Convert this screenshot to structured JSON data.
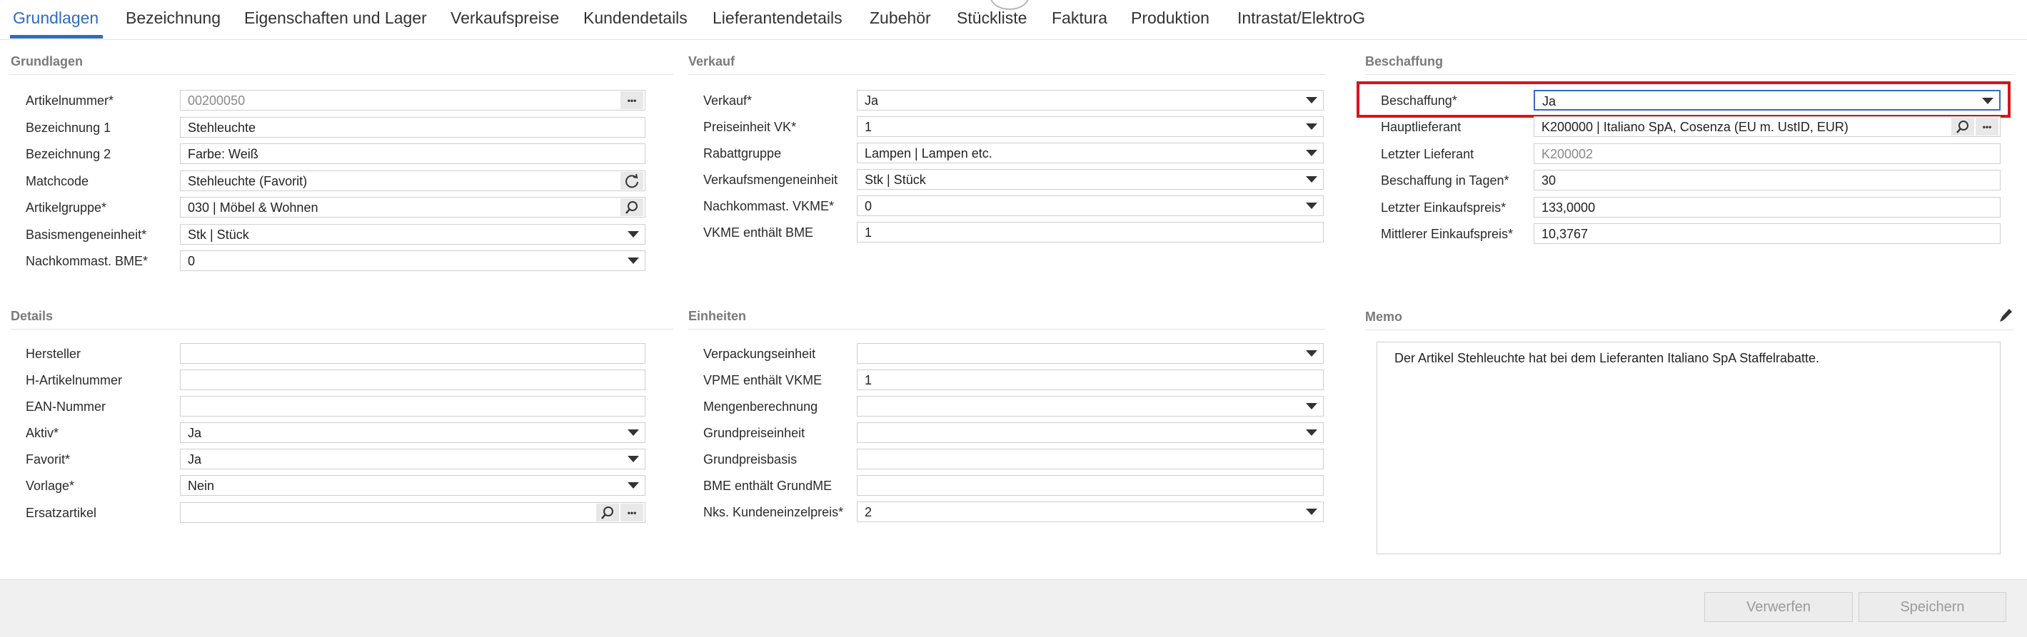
{
  "tabs": [
    {
      "label": "Grundlagen",
      "active": true
    },
    {
      "label": "Bezeichnung"
    },
    {
      "label": "Eigenschaften und Lager"
    },
    {
      "label": "Verkaufspreise"
    },
    {
      "label": "Kundendetails"
    },
    {
      "label": "Lieferantendetails"
    },
    {
      "label": "Zubehör"
    },
    {
      "label": "Stückliste"
    },
    {
      "label": "Faktura"
    },
    {
      "label": "Produktion"
    },
    {
      "label": "Intrastat/ElektroG"
    }
  ],
  "grundlagen": {
    "title": "Grundlagen",
    "fields": [
      {
        "label": "Artikelnummer*",
        "value": "00200050"
      },
      {
        "label": "Bezeichnung 1",
        "value": "Stehleuchte"
      },
      {
        "label": "Bezeichnung 2",
        "value": "Farbe: Weiß"
      },
      {
        "label": "Matchcode",
        "value": "Stehleuchte  (Favorit)"
      },
      {
        "label": "Artikelgruppe*",
        "value": "030 | Möbel & Wohnen"
      },
      {
        "label": "Basismengeneinheit*",
        "value": "Stk  |  Stück"
      },
      {
        "label": "Nachkommast. BME*",
        "value": "0"
      }
    ]
  },
  "verkauf": {
    "title": "Verkauf",
    "fields": [
      {
        "label": "Verkauf*",
        "value": "Ja"
      },
      {
        "label": "Preiseinheit VK*",
        "value": "1"
      },
      {
        "label": "Rabattgruppe",
        "value": "Lampen  |  Lampen etc."
      },
      {
        "label": "Verkaufsmengeneinheit",
        "value": "Stk  |  Stück"
      },
      {
        "label": "Nachkommast. VKME*",
        "value": "0"
      },
      {
        "label": "VKME enthält BME",
        "value": "1"
      }
    ]
  },
  "beschaffung": {
    "title": "Beschaffung",
    "fields": [
      {
        "label": "Beschaffung*",
        "value": "Ja"
      },
      {
        "label": "Hauptlieferant",
        "value": "K200000  |  Italiano SpA, Cosenza (EU m. UstID, EUR)"
      },
      {
        "label": "Letzter Lieferant",
        "value": "K200002"
      },
      {
        "label": "Beschaffung in Tagen*",
        "value": "30"
      },
      {
        "label": "Letzter Einkaufspreis*",
        "value": "133,0000"
      },
      {
        "label": "Mittlerer Einkaufspreis*",
        "value": "10,3767"
      }
    ]
  },
  "details": {
    "title": "Details",
    "fields": [
      {
        "label": "Hersteller",
        "value": ""
      },
      {
        "label": "H-Artikelnummer",
        "value": ""
      },
      {
        "label": "EAN-Nummer",
        "value": ""
      },
      {
        "label": "Aktiv*",
        "value": "Ja"
      },
      {
        "label": "Favorit*",
        "value": "Ja"
      },
      {
        "label": "Vorlage*",
        "value": "Nein"
      },
      {
        "label": "Ersatzartikel",
        "value": ""
      }
    ]
  },
  "einheiten": {
    "title": "Einheiten",
    "fields": [
      {
        "label": "Verpackungseinheit",
        "value": ""
      },
      {
        "label": "VPME enthält VKME",
        "value": "1"
      },
      {
        "label": "Mengenberechnung",
        "value": ""
      },
      {
        "label": "Grundpreiseinheit",
        "value": ""
      },
      {
        "label": "Grundpreisbasis",
        "value": ""
      },
      {
        "label": "BME enthält GrundME",
        "value": ""
      },
      {
        "label": "Nks. Kundeneinzelpreis*",
        "value": "2"
      }
    ]
  },
  "memo": {
    "title": "Memo",
    "text": "Der Artikel Stehleuchte hat bei dem Lieferanten Italiano SpA Staffelrabatte."
  },
  "footer": {
    "discard_label": "Verwerfen",
    "save_label": "Speichern"
  },
  "colors": {
    "accent": "#2f6cc1",
    "highlight": "#d9141a"
  }
}
